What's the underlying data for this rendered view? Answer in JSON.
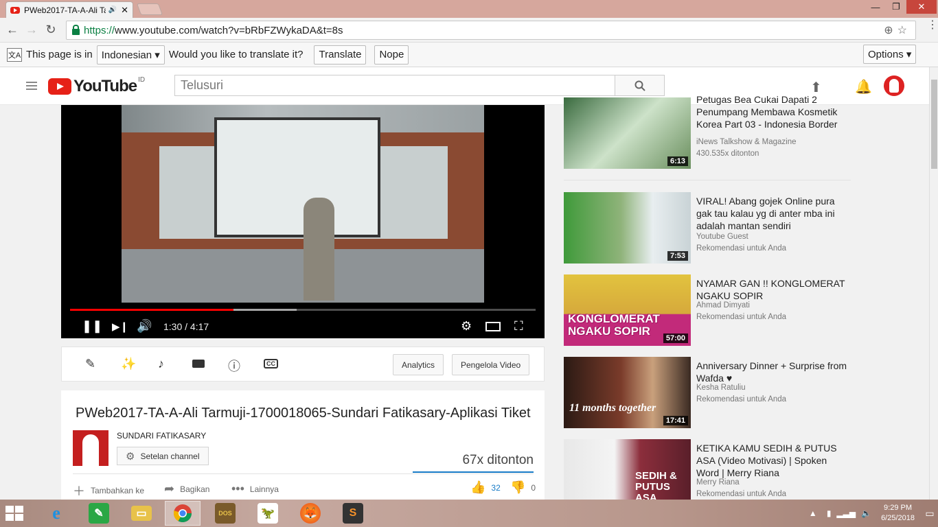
{
  "browser": {
    "tab_title": "PWeb2017-TA-A-Ali Ta",
    "tab_audio_icon": "speaker-icon",
    "tab_close": "✕",
    "url_scheme": "https://",
    "url_rest": "www.youtube.com/watch?v=bRbFZWykaDA&t=8s",
    "win_min": "—",
    "win_max": "❐",
    "win_close": "✕"
  },
  "translate_bar": {
    "prefix": "This page is in",
    "language": "Indonesian ▾",
    "question": "Would you like to translate it?",
    "translate_label": "Translate",
    "nope_label": "Nope",
    "options_label": "Options ▾"
  },
  "youtube": {
    "logo_text": "YouTube",
    "region": "ID",
    "search_placeholder": "Telusuri"
  },
  "player": {
    "time": "1:30 / 4:17",
    "played_fraction": 0.351,
    "loaded_fraction": 0.487
  },
  "creator": {
    "analytics_label": "Analytics",
    "manager_label": "Pengelola Video"
  },
  "video": {
    "title": "PWeb2017-TA-A-Ali Tarmuji-1700018065-Sundari Fatikasary-Aplikasi Tiket",
    "channel": "SUNDARI FATIKASARY",
    "channel_settings": "Setelan channel",
    "views": "67x ditonton",
    "add_to": "Tambahkan ke",
    "share": "Bagikan",
    "more": "Lainnya",
    "likes": "32",
    "dislikes": "0"
  },
  "related": [
    {
      "title": "Petugas Bea Cukai Dapati 2 Penumpang Membawa Kosmetik Korea Part 03 - Indonesia Border",
      "channel": "iNews Talkshow & Magazine",
      "meta": "430.535x ditonton",
      "duration": "6:13"
    },
    {
      "title": "VIRAL! Abang gojek Online pura gak tau kalau yg di anter mba ini adalah mantan sendiri",
      "channel": "Youtube Guest",
      "meta": "Rekomendasi untuk Anda",
      "duration": "7:53"
    },
    {
      "title": "NYAMAR GAN !! KONGLOMERAT NGAKU SOPIR",
      "channel": "Ahmad Dimyati",
      "meta": "Rekomendasi untuk Anda",
      "duration": "57:00",
      "overlay": "KONGLOMERAT NGAKU SOPIR"
    },
    {
      "title": "Anniversary Dinner + Surprise from Wafda ♥",
      "channel": "Kesha Ratuliu",
      "meta": "Rekomendasi untuk Anda",
      "duration": "17:41",
      "overlay": "11 months together"
    },
    {
      "title": "KETIKA KAMU SEDIH & PUTUS ASA (Video Motivasi) | Spoken Word | Merry Riana",
      "channel": "Merry Riana",
      "meta": "Rekomendasi untuk Anda",
      "duration": "",
      "overlay": "SEDIH & PUTUS ASA"
    }
  ],
  "taskbar": {
    "time": "9:29 PM",
    "date": "6/25/2018"
  }
}
